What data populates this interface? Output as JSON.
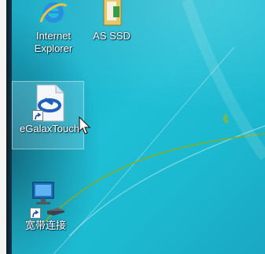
{
  "desktop": {
    "icons": [
      {
        "label_lines": [
          "Internet",
          "Explorer"
        ],
        "icon": "internet-explorer-icon"
      },
      {
        "label_lines": [
          "AS SSD"
        ],
        "icon": "folder-icon"
      },
      {
        "label_lines": [
          "eGalaxTouch"
        ],
        "icon": "egalaxtouch-icon"
      },
      {
        "label_lines": [
          "宽带连接"
        ],
        "icon": "broadband-connection-icon"
      }
    ],
    "shortcut_arrow_icon": "shortcut-arrow-icon",
    "cursor_icon": "mouse-cursor-icon"
  },
  "colors": {
    "wallpaper": "#1fbfd6",
    "wallpaper_line": "#7fae2a",
    "label_text": "#ffffff"
  }
}
